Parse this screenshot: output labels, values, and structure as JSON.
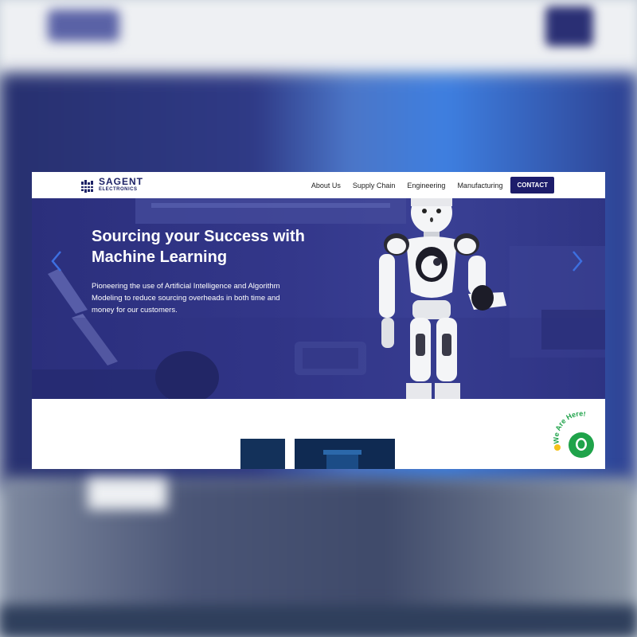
{
  "nav": {
    "logo_name": "SAGENT",
    "logo_sub": "ELECTRONICS",
    "items": [
      "About Us",
      "Supply Chain",
      "Engineering",
      "Manufacturing"
    ],
    "contact_label": "CONTACT"
  },
  "hero": {
    "title": "Sourcing your Success with Machine Learning",
    "description": "Pioneering the use of Artificial Intelligence and Algorithm Modeling to reduce sourcing overheads in both time and money for our customers.",
    "prev_icon": "chevron-left-icon",
    "next_icon": "chevron-right-icon"
  },
  "chat_widget": {
    "label": "We Are Here!",
    "icon": "chat-bubble-icon"
  },
  "colors": {
    "brand_navy": "#1d1d6b",
    "hero_bg": "#33378a",
    "arrow_blue": "#3d6fe0",
    "chat_green": "#1fa34a"
  }
}
